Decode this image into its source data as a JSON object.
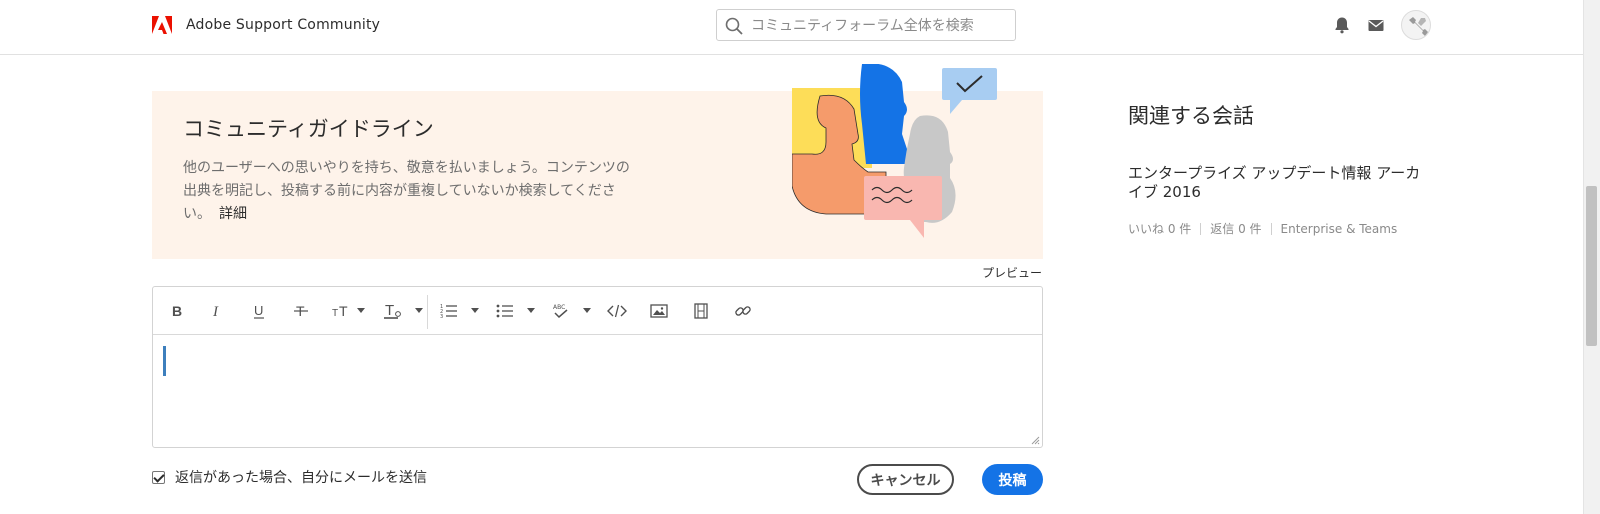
{
  "header": {
    "brand": "Adobe Support Community",
    "search_placeholder": "コミュニティフォーラム全体を検索"
  },
  "guidelines": {
    "title": "コミュニティガイドライン",
    "text": "他のユーザーへの思いやりを持ち、敬意を払いましょう。コンテンツの出典を明記し、投稿する前に内容が重複していないか検索してください。",
    "link": "詳細"
  },
  "editor": {
    "preview_label": "プレビュー",
    "toolbar": [
      "bold",
      "italic",
      "underline",
      "strikethrough",
      "font-size",
      "text-color",
      "numbered-list",
      "bulleted-list",
      "spellcheck",
      "code",
      "image",
      "video",
      "link"
    ]
  },
  "footer": {
    "notify_label": "返信があった場合、自分にメールを送信",
    "notify_checked": true,
    "cancel_label": "キャンセル",
    "post_label": "投稿"
  },
  "related": {
    "title": "関連する会話",
    "item_title": "エンタープライズ アップデート情報 アーカイブ 2016",
    "likes": "いいね 0 件",
    "replies": "返信 0 件",
    "board": "Enterprise & Teams"
  },
  "colors": {
    "accent": "#1473e6",
    "adobe_red": "#eb1000",
    "banner_bg": "#fef3ea"
  }
}
